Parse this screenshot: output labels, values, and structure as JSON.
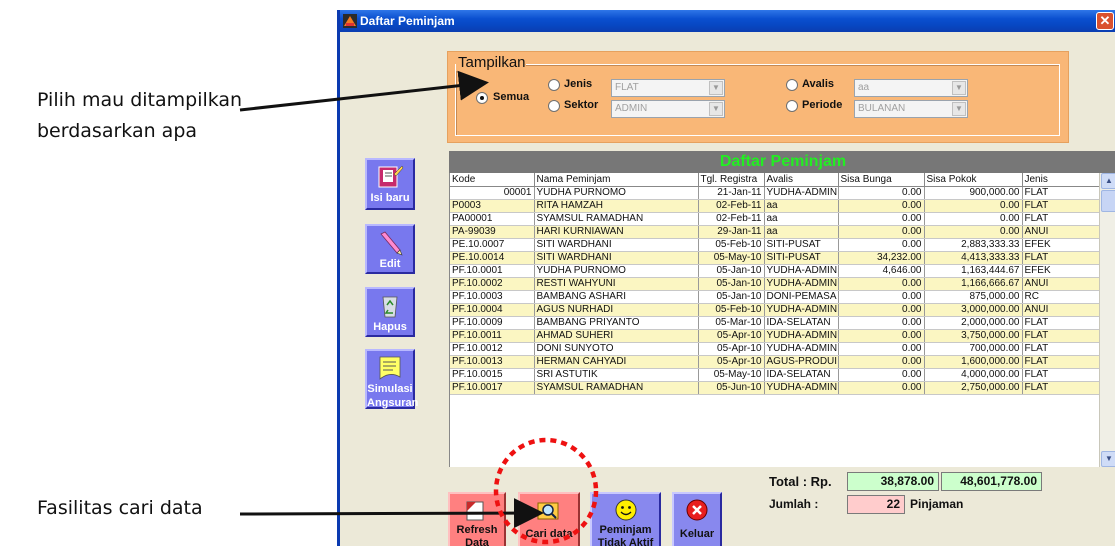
{
  "annotations": {
    "pilih_line1": "Pilih mau ditampilkan",
    "pilih_line2": "berdasarkan apa",
    "cari": "Fasilitas cari data"
  },
  "window": {
    "title": "Daftar Peminjam",
    "close_glyph": "✕"
  },
  "filter": {
    "legend": "Tampilkan",
    "semua": "Semua",
    "jenis": "Jenis",
    "jenis_value": "FLAT",
    "sektor": "Sektor",
    "sektor_value": "ADMIN",
    "avalis": "Avalis",
    "avalis_value": "aa",
    "periode": "Periode",
    "periode_value": "BULANAN",
    "selected": "semua"
  },
  "grid": {
    "title": "Daftar Peminjam",
    "columns": [
      "Kode",
      "Nama Peminjam",
      "Tgl. Registra",
      "Avalis",
      "Sisa Bunga",
      "Sisa Pokok",
      "Jenis"
    ],
    "rows": [
      [
        "00001",
        "YUDHA PURNOMO",
        "21-Jan-11",
        "YUDHA-ADMIN",
        "0.00",
        "900,000.00",
        "FLAT"
      ],
      [
        "P0003",
        "RITA HAMZAH",
        "02-Feb-11",
        "aa",
        "0.00",
        "0.00",
        "FLAT"
      ],
      [
        "PA00001",
        "SYAMSUL RAMADHAN",
        "02-Feb-11",
        "aa",
        "0.00",
        "0.00",
        "FLAT"
      ],
      [
        "PA-99039",
        "HARI KURNIAWAN",
        "29-Jan-11",
        "aa",
        "0.00",
        "0.00",
        "ANUI"
      ],
      [
        "PE.10.0007",
        "SITI WARDHANI",
        "05-Feb-10",
        "SITI-PUSAT",
        "0.00",
        "2,883,333.33",
        "EFEK"
      ],
      [
        "PE.10.0014",
        "SITI WARDHANI",
        "05-May-10",
        "SITI-PUSAT",
        "34,232.00",
        "4,413,333.33",
        "FLAT"
      ],
      [
        "PF.10.0001",
        "YUDHA PURNOMO",
        "05-Jan-10",
        "YUDHA-ADMIN",
        "4,646.00",
        "1,163,444.67",
        "EFEK"
      ],
      [
        "PF.10.0002",
        "RESTI WAHYUNI",
        "05-Jan-10",
        "YUDHA-ADMIN",
        "0.00",
        "1,166,666.67",
        "ANUI"
      ],
      [
        "PF.10.0003",
        "BAMBANG ASHARI",
        "05-Jan-10",
        "DONI-PEMASA",
        "0.00",
        "875,000.00",
        "RC"
      ],
      [
        "PF.10.0004",
        "AGUS NURHADI",
        "05-Feb-10",
        "YUDHA-ADMIN",
        "0.00",
        "3,000,000.00",
        "ANUI"
      ],
      [
        "PF.10.0009",
        "BAMBANG PRIYANTO",
        "05-Mar-10",
        "IDA-SELATAN",
        "0.00",
        "2,000,000.00",
        "FLAT"
      ],
      [
        "PF.10.0011",
        "AHMAD SUHERI",
        "05-Apr-10",
        "YUDHA-ADMIN",
        "0.00",
        "3,750,000.00",
        "FLAT"
      ],
      [
        "PF.10.0012",
        "DONI SUNYOTO",
        "05-Apr-10",
        "YUDHA-ADMIN",
        "0.00",
        "700,000.00",
        "FLAT"
      ],
      [
        "PF.10.0013",
        "HERMAN CAHYADI",
        "05-Apr-10",
        "AGUS-PRODUI",
        "0.00",
        "1,600,000.00",
        "FLAT"
      ],
      [
        "PF.10.0015",
        "SRI ASTUTIK",
        "05-May-10",
        "IDA-SELATAN",
        "0.00",
        "4,000,000.00",
        "FLAT"
      ],
      [
        "PF.10.0017",
        "SYAMSUL RAMADHAN",
        "05-Jun-10",
        "YUDHA-ADMIN",
        "0.00",
        "2,750,000.00",
        "FLAT"
      ]
    ]
  },
  "side_buttons": {
    "isi_baru": "Isi baru",
    "edit": "Edit",
    "hapus": "Hapus",
    "simulasi_1": "Simulasi",
    "simulasi_2": "Angsuran"
  },
  "totals": {
    "total_label": "Total :  Rp.",
    "sisa_bunga_total": "38,878.00",
    "sisa_pokok_total": "48,601,778.00",
    "jumlah_label": "Jumlah :",
    "jumlah_value": "22",
    "pinjaman_label": "Pinjaman"
  },
  "bottom_buttons": {
    "refresh_1": "Refresh",
    "refresh_2": "Data",
    "cari": "Cari data",
    "peminjam_1": "Peminjam",
    "peminjam_2": "Tidak Aktif",
    "keluar": "Keluar"
  },
  "colors": {
    "titlebar": "#0a4fcf",
    "panel": "#f9b777",
    "grid_header": "#777777",
    "grid_title_text": "#22ee22",
    "row_alt": "#fbf6c2",
    "side_button": "#7878ee",
    "total_box": "#ccffcc",
    "jumlah_box": "#ffcccc",
    "highlight_circle": "#ee1111"
  }
}
